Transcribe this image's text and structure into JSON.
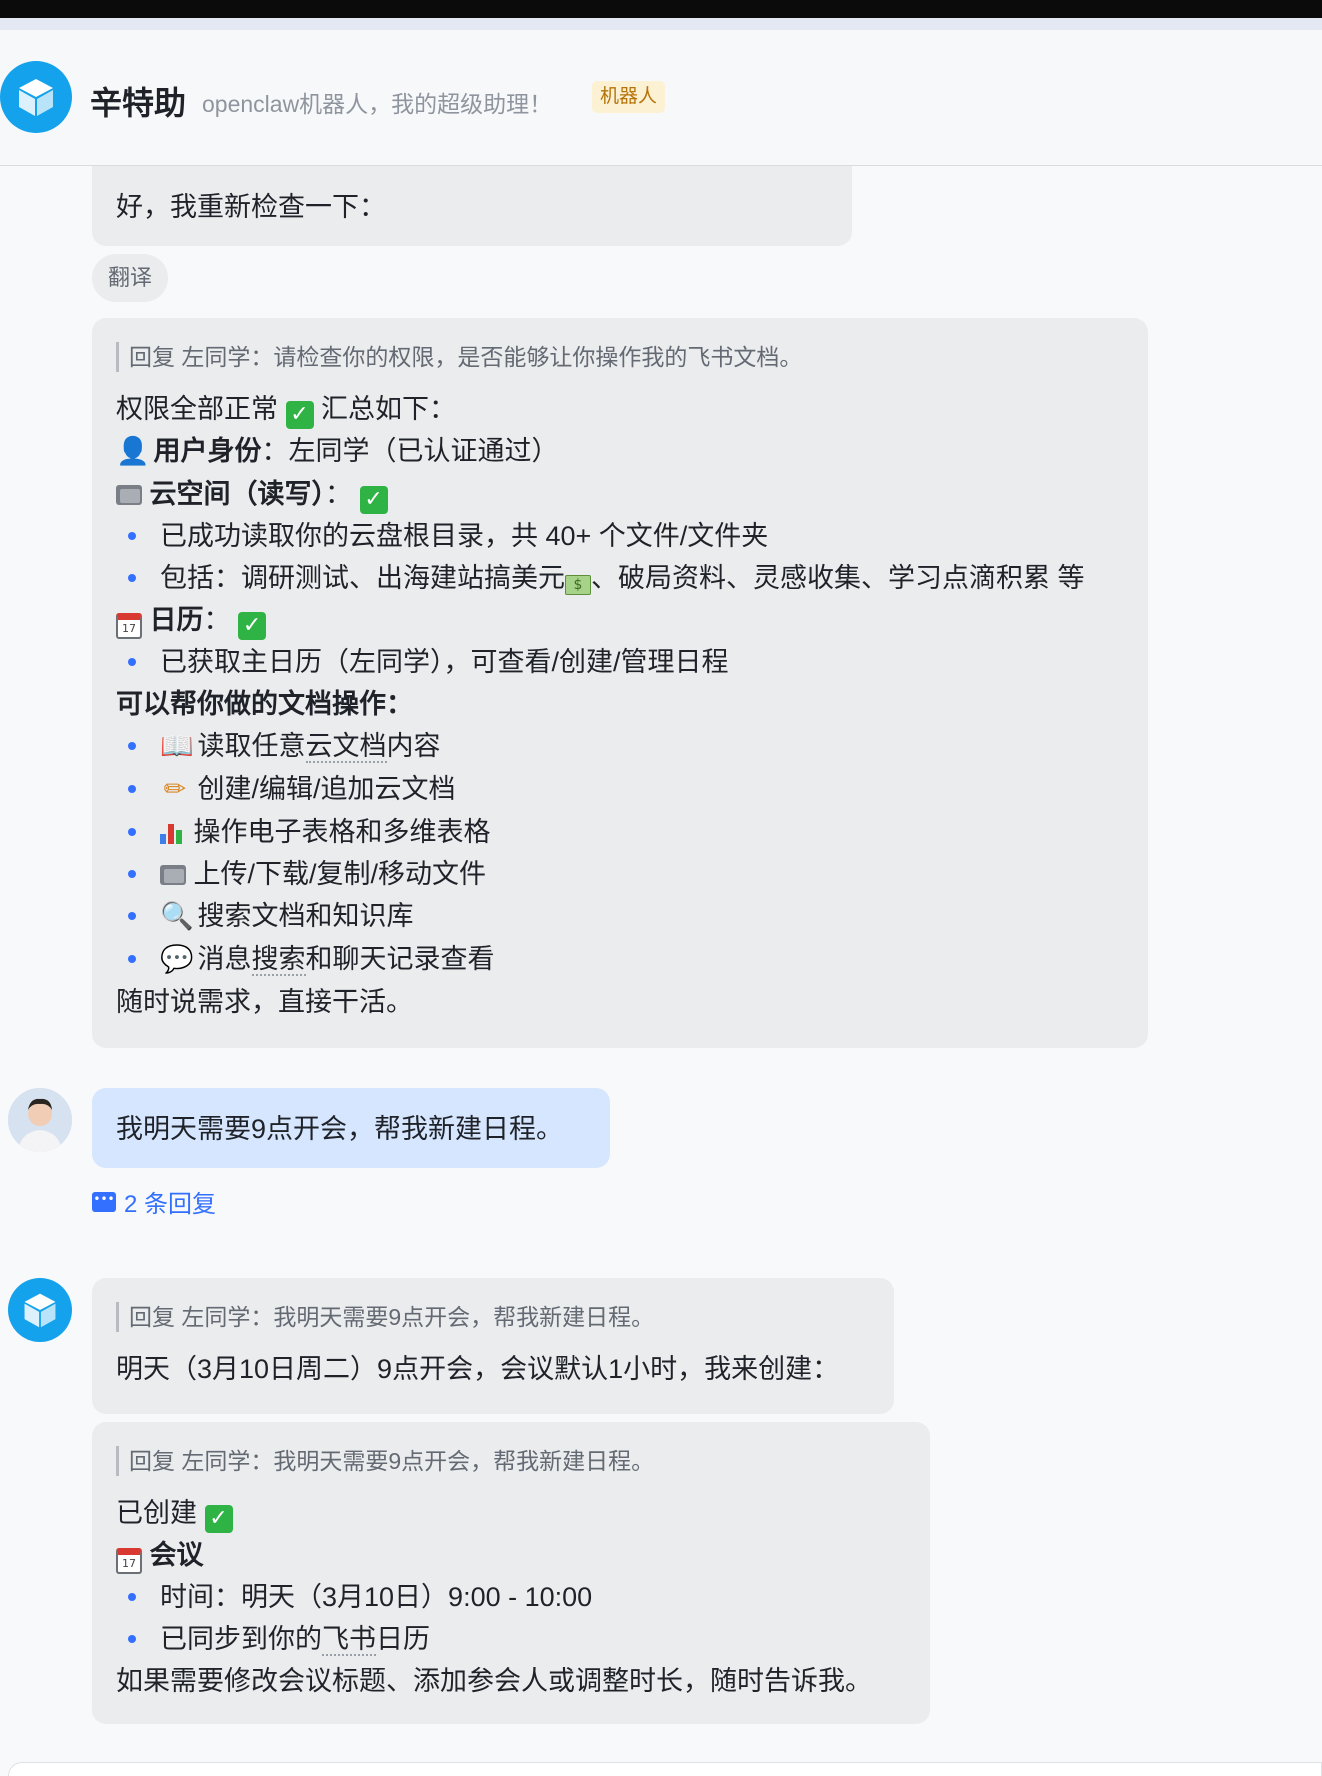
{
  "header": {
    "name": "辛特助",
    "description": "openclaw机器人，我的超级助理！",
    "badge": "机器人"
  },
  "messages": {
    "m1": {
      "text": "好，我重新检查一下：",
      "translate_label": "翻译"
    },
    "m2": {
      "quote": "回复 左同学：请检查你的权限，是否能够让你操作我的飞书文档。",
      "intro": "权限全部正常",
      "intro_suffix": "汇总如下：",
      "identity_label": "用户身份",
      "identity_value": "：左同学（已认证通过）",
      "space_label": "云空间（读写）",
      "space_colon": "：",
      "space_item1": "已成功读取你的云盘根目录，共 40+ 个文件/文件夹",
      "space_item2_a": "包括：调研测试、出海建站搞美元",
      "space_item2_b": "、破局资料、灵感收集、学习点滴积累 等",
      "calendar_label": "日历",
      "calendar_colon": "：",
      "calendar_item": "已获取主日历（左同学），可查看/创建/管理日程",
      "ops_title": "可以帮你做的文档操作：",
      "ops": {
        "o1_a": "读取任意",
        "o1_b": "云文档",
        "o1_c": "内容",
        "o2": "创建/编辑/追加云文档",
        "o3": "操作电子表格和多维表格",
        "o4": "上传/下载/复制/移动文件",
        "o5": "搜索文档和知识库",
        "o6_a": "消息",
        "o6_b": "搜索",
        "o6_c": "和聊天记录查看"
      },
      "closing": "随时说需求，直接干活。"
    },
    "m3": {
      "text": "我明天需要9点开会，帮我新建日程。",
      "reply_count": "2 条回复"
    },
    "m4": {
      "quote": "回复 左同学：我明天需要9点开会，帮我新建日程。",
      "text": "明天（3月10日周二）9点开会，会议默认1小时，我来创建："
    },
    "m5": {
      "quote": "回复 左同学：我明天需要9点开会，帮我新建日程。",
      "created": "已创建",
      "event_title": "会议",
      "time": "时间：明天（3月10日）9:00 - 10:00",
      "sync_a": "已同步到你的",
      "sync_b": "飞书",
      "sync_c": "日历",
      "closing": "如果需要修改会议标题、添加参会人或调整时长，随时告诉我。"
    }
  },
  "icons": {
    "bot": "cube-icon",
    "check": "check-icon",
    "calendar": "calendar-icon",
    "folder": "folder-icon",
    "user": "user-icon",
    "book": "book-icon",
    "pencil": "pencil-icon",
    "chart": "chart-icon",
    "search": "magnifier-icon",
    "speech": "speech-bubble-icon",
    "money": "money-icon",
    "reply": "reply-icon"
  },
  "colors": {
    "accent": "#3370ff",
    "bot_avatar": "#14a2ec",
    "check": "#2fb344",
    "badge_bg": "#fdf1d4",
    "badge_text": "#b5730a"
  }
}
